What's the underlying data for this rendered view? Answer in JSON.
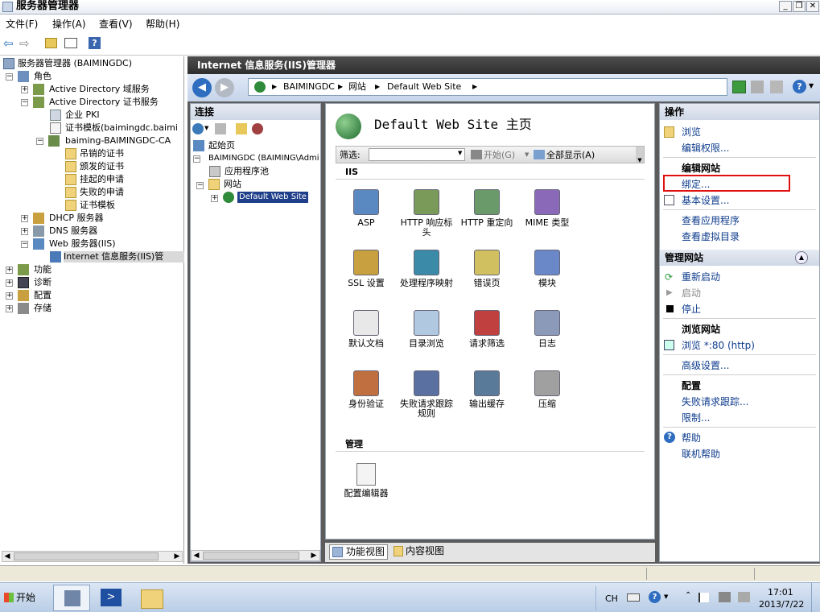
{
  "window": {
    "title": "服务器管理器"
  },
  "menu": [
    "文件(F)",
    "操作(A)",
    "查看(V)",
    "帮助(H)"
  ],
  "tree": {
    "root": "服务器管理器 (BAIMINGDC)",
    "roles": "角色",
    "ad_domain": "Active Directory 域服务",
    "ad_cert": "Active Directory 证书服务",
    "pki": "企业 PKI",
    "cert_template": "证书模板(baimingdc.baimi",
    "ca": "baiming-BAIMINGDC-CA",
    "revoked": "吊销的证书",
    "issued": "颁发的证书",
    "pending": "挂起的申请",
    "failed": "失败的申请",
    "templates": "证书模板",
    "dhcp": "DHCP 服务器",
    "dns": "DNS 服务器",
    "web": "Web 服务器(IIS)",
    "iis": "Internet 信息服务(IIS)管",
    "features": "功能",
    "diagnostics": "诊断",
    "config": "配置",
    "storage": "存储"
  },
  "iis": {
    "title": "Internet 信息服务(IIS)管理器",
    "breadcrumb": [
      "BAIMINGDC",
      "网站",
      "Default Web Site"
    ],
    "connections": {
      "header": "连接",
      "start": "起始页",
      "server": "BAIMINGDC (BAIMING\\Admi",
      "apppools": "应用程序池",
      "sites": "网站",
      "site": "Default Web Site"
    },
    "main": {
      "title": "Default Web Site 主页",
      "filter_label": "筛选:",
      "go": "开始(G)",
      "show_all": "全部显示(A)",
      "group_iis": "IIS",
      "group_manage": "管理",
      "features": [
        {
          "label": "ASP",
          "icon": "asp-icon"
        },
        {
          "label": "HTTP 响应标头",
          "icon": "http-headers-icon"
        },
        {
          "label": "HTTP 重定向",
          "icon": "http-redirect-icon"
        },
        {
          "label": "MIME 类型",
          "icon": "mime-icon"
        },
        {
          "label": "SSL 设置",
          "icon": "lock-icon"
        },
        {
          "label": "处理程序映射",
          "icon": "handler-icon"
        },
        {
          "label": "错误页",
          "icon": "error-page-icon"
        },
        {
          "label": "模块",
          "icon": "modules-icon"
        },
        {
          "label": "默认文档",
          "icon": "default-doc-icon"
        },
        {
          "label": "目录浏览",
          "icon": "dir-browse-icon"
        },
        {
          "label": "请求筛选",
          "icon": "request-filter-icon"
        },
        {
          "label": "日志",
          "icon": "log-icon"
        },
        {
          "label": "身份验证",
          "icon": "auth-icon"
        },
        {
          "label": "失败请求跟踪规则",
          "icon": "failed-trace-icon"
        },
        {
          "label": "输出缓存",
          "icon": "output-cache-icon"
        },
        {
          "label": "压缩",
          "icon": "compression-icon"
        }
      ],
      "config_editor": "配置编辑器"
    },
    "views": {
      "features": "功能视图",
      "content": "内容视图"
    },
    "actions": {
      "header": "操作",
      "browse": "浏览",
      "edit_perms": "编辑权限...",
      "edit_site": "编辑网站",
      "bindings": "绑定...",
      "basic": "基本设置...",
      "view_apps": "查看应用程序",
      "view_vdirs": "查看虚拟目录",
      "manage_site": "管理网站",
      "restart": "重新启动",
      "start": "启动",
      "stop": "停止",
      "browse_site": "浏览网站",
      "browse_80": "浏览 *:80 (http)",
      "advanced": "高级设置...",
      "configure": "配置",
      "failed_tracing": "失败请求跟踪...",
      "limits": "限制...",
      "help": "帮助",
      "online_help": "联机帮助"
    }
  },
  "taskbar": {
    "start": "开始",
    "lang": "CH",
    "time": "17:01",
    "date": "2013/7/22"
  }
}
